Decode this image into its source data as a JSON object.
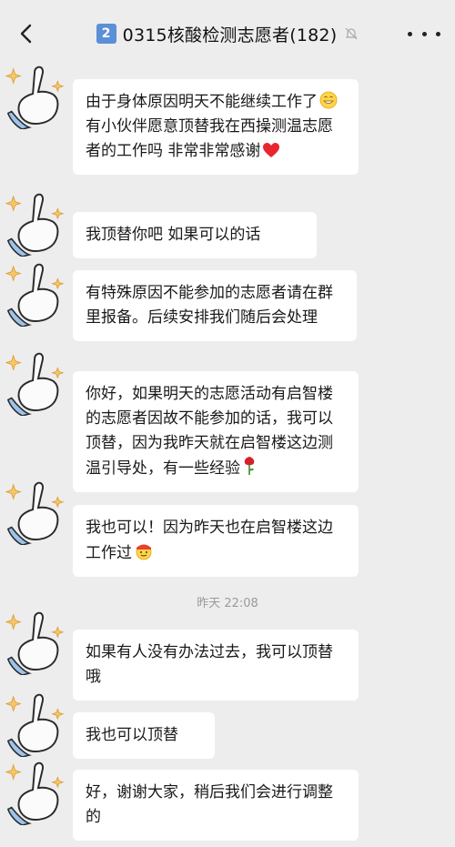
{
  "header": {
    "badge": "2",
    "title": "0315核酸检测志愿者(182)",
    "icons": [
      "back-arrow-icon",
      "mute-bell-icon",
      "more-icon"
    ]
  },
  "timestamp": "昨天 22:08",
  "messages": [
    {
      "text": "由于身体原因明天不能继续工作了",
      "text2": "  有小伙伴愿意顶替我在西操测温志愿者的工作吗  非常非常感谢",
      "emoji1": "grinning-face-icon",
      "emoji2": "red-heart-icon"
    },
    {
      "text": "我顶替你吧 如果可以的话"
    },
    {
      "text": "有特殊原因不能参加的志愿者请在群里报备。后续安排我们随后会处理"
    },
    {
      "text": "你好，如果明天的志愿活动有启智楼的志愿者因故不能参加的话，我可以顶替，因为我昨天就在启智楼这边测温引导处，有一些经验",
      "emoji": "rose-icon"
    },
    {
      "text": "我也可以！因为昨天也在启智楼这边工作过",
      "emoji": "face-with-hat-icon"
    },
    {
      "text": "如果有人没有办法过去，我可以顶替哦"
    },
    {
      "text": "我也可以顶替"
    },
    {
      "text": "好，谢谢大家，稍后我们会进行调整的"
    }
  ]
}
